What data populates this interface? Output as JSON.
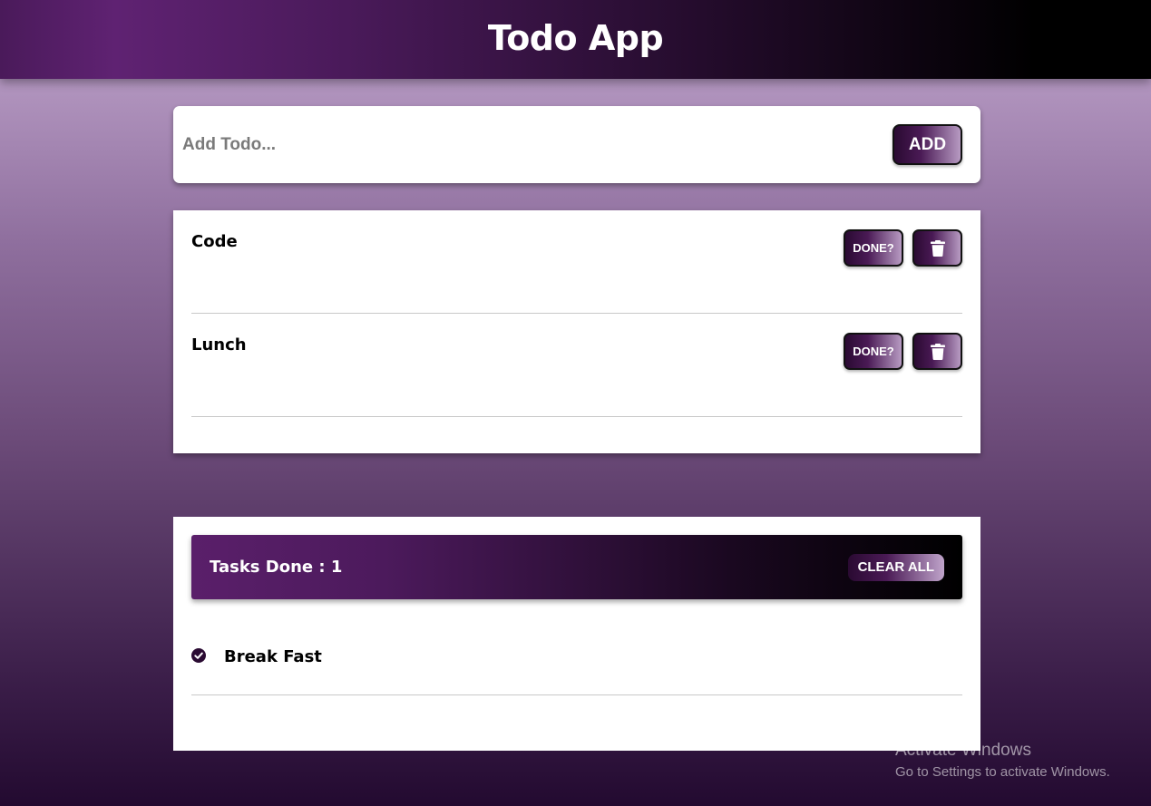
{
  "header": {
    "title": "Todo App"
  },
  "add_todo": {
    "placeholder": "Add Todo...",
    "value": "",
    "add_label": "ADD"
  },
  "todos": [
    {
      "label": "Code",
      "done_label": "DONE?",
      "delete_icon": "trash-icon"
    },
    {
      "label": "Lunch",
      "done_label": "DONE?",
      "delete_icon": "trash-icon"
    }
  ],
  "done_section": {
    "title": "Tasks Done : 1",
    "clear_label": "CLEAR ALL",
    "items": [
      {
        "label": "Break Fast",
        "icon": "check-circle-icon"
      }
    ]
  },
  "watermark": {
    "title": "Activate Windows",
    "subtitle": "Go to Settings to activate Windows."
  },
  "colors": {
    "header_start": "#5f2272",
    "header_end": "#000000",
    "accent": "#4a1a55"
  }
}
